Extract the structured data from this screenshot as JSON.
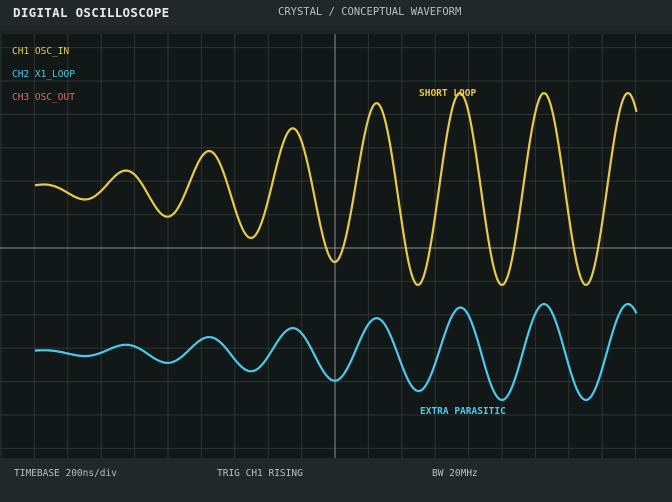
{
  "header": {
    "title": "DIGITAL OSCILLOSCOPE",
    "subtitle": "CRYSTAL / CONCEPTUAL WAVEFORM"
  },
  "channels": [
    {
      "label": "CH1 OSC_IN",
      "color": "#e8c84a"
    },
    {
      "label": "CH2 X1_LOOP",
      "color": "#4ec8ea"
    },
    {
      "label": "CH3 OSC_OUT",
      "color": "#e06a62"
    }
  ],
  "annotations": {
    "short_loop": "SHORT LOOP",
    "extra_parasitic": "EXTRA PARASITIC"
  },
  "footer": {
    "timebase": "TIMEBASE  200ns/div",
    "trigger": "TRIG  CH1  RISING",
    "bandwidth": "BW  20MHz"
  },
  "colors": {
    "screen_bg": "#121817",
    "grid": "#2b3432",
    "axis": "#8a908e"
  }
}
